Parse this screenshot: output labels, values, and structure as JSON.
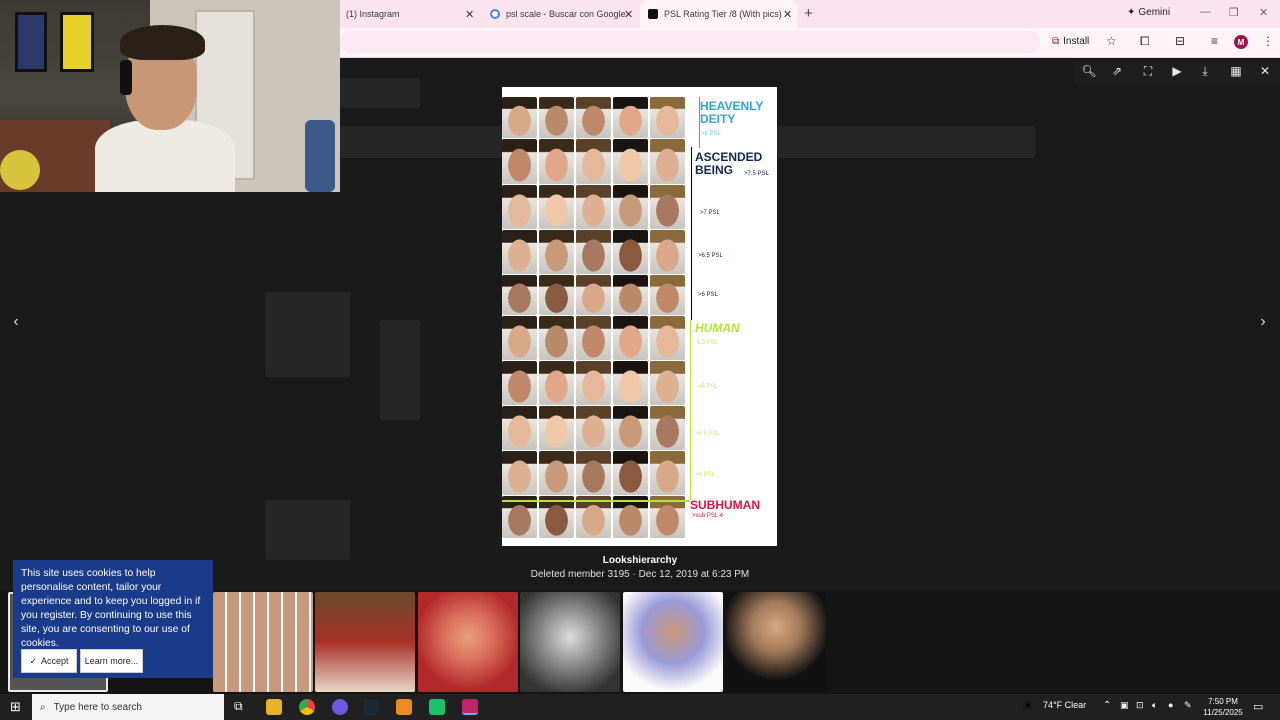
{
  "tabs": [
    {
      "label": "(1) Instagram",
      "favicon_color": "#e1306c"
    },
    {
      "label": "psl scale - Buscar con Google",
      "favicon_color": "#4285f4"
    },
    {
      "label": "PSL Rating Tier /8 (With pics) | L",
      "favicon_color": "#111111"
    }
  ],
  "tab_close": "✕",
  "new_tab": "+",
  "gemini_label": "Gemini",
  "install_label": "Install",
  "avatar_letter": "M",
  "nav": {
    "prev": "‹",
    "next": "›"
  },
  "lightbox_tools": [
    "zoom-icon",
    "open-external-icon",
    "fullscreen-icon",
    "play-icon",
    "download-icon",
    "grid-icon",
    "close-icon"
  ],
  "chart": {
    "tiers": [
      {
        "name_line1": "HEAVENLY",
        "name_line2": "DEITY",
        "psl": ">8 PSL",
        "color": "#2aa6d8"
      },
      {
        "name_line1": "ASCENDED",
        "name_line2": "BEING",
        "psl": ">7.5 PSL",
        "color": "#0f2a4a"
      },
      {
        "name_line1": "HUMAN",
        "name_line2": "",
        "psl": "5.5 PSL",
        "color": "#b7e23a"
      },
      {
        "name_line1": "SUBHUMAN",
        "name_line2": "",
        "psl": ">sub PSL 4",
        "color": "#d6163c"
      }
    ],
    "psl_levels": [
      ">7 PSL",
      ">6.5 PSL",
      ">6 PSL",
      ">5 PSL",
      ">4.5 PSL",
      ">4 PSL"
    ]
  },
  "caption": {
    "title": "Lookshierarchy",
    "subtitle": "Deleted member 3195 · Dec 12, 2019 at 6:23 PM"
  },
  "cookie": {
    "text": "This site uses cookies to help personalise content, tailor your experience and to keep you logged in if you register. By continuing to use this site, you are consenting to our use of cookies.",
    "accept": "Accept",
    "learn_more": "Learn more..."
  },
  "taskbar": {
    "search_placeholder": "Type here to search",
    "weather": "74°F  Clear",
    "time": "7:50 PM",
    "date": "11/25/2025"
  }
}
